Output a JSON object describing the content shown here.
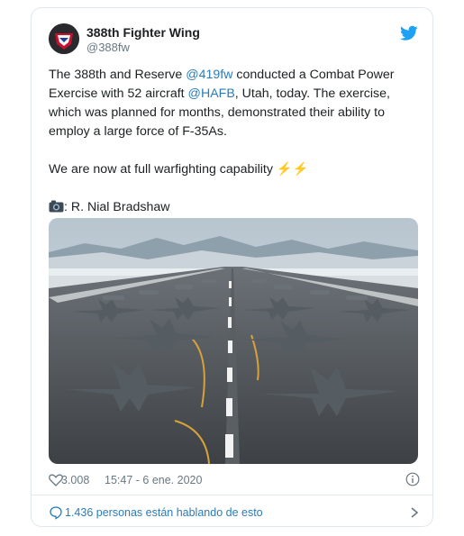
{
  "tweet": {
    "author_name": "388th Fighter Wing",
    "author_handle": "@388fw",
    "text_line1_a": "The 388th and Reserve ",
    "mention_1": "@419fw",
    "text_line1_b": " conducted a Combat Power",
    "text_line2_a": "Exercise with 52 aircraft ",
    "mention_2": "@HAFB",
    "text_line2_b": ", Utah, today. The exercise,",
    "text_line3": "which was planned for months, demonstrated their ability to",
    "text_line4": "employ a large force of F-35As.",
    "text_line5": "We are now at full warfighting capability ⚡⚡",
    "photo_credit": ": R. Nial Bradshaw",
    "likes": "3.008",
    "timestamp": "15:47 - 6 ene. 2020",
    "conversation": "1.436 personas están hablando de esto"
  },
  "colors": {
    "link": "#2b7bb9",
    "muted": "#697882",
    "twitter_blue": "#1da1f2"
  },
  "icons": [
    "avatar",
    "twitter-bird-icon",
    "camera-emoji-icon",
    "heart-icon",
    "info-icon",
    "speech-bubble-icon",
    "chevron-right-icon"
  ]
}
